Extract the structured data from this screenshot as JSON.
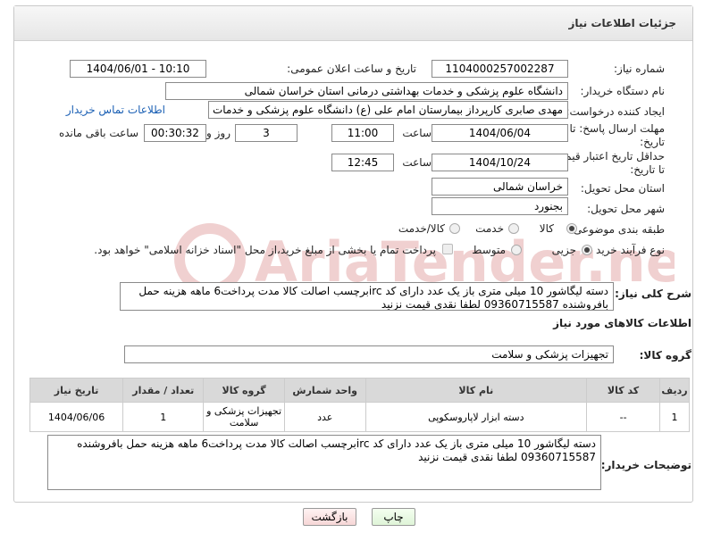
{
  "header": {
    "title": "جزئیات اطلاعات نیاز"
  },
  "fields": {
    "need_number_label": "شماره نیاز:",
    "need_number": "1104000257002287",
    "announce_label": "تاریخ و ساعت اعلان عمومی:",
    "announce_value": "1404/06/01 - 10:10",
    "buyer_org_label": "نام دستگاه خریدار:",
    "buyer_org": "دانشگاه علوم پزشکی و خدمات بهداشتی درمانی استان خراسان شمالی",
    "creator_label": "ایجاد کننده درخواست:",
    "creator": "مهدی صابری کارپرداز بیمارستان امام علی (ع) دانشگاه علوم پزشکی و خدمات بهداشتی",
    "contact_link": "اطلاعات تماس خریدار",
    "deadline_label": "مهلت ارسال پاسخ: تا تاریخ:",
    "deadline_date": "1404/06/04",
    "time_label": "ساعت",
    "deadline_time": "11:00",
    "days_value": "3",
    "days_label": "روز و",
    "remaining_time": "00:30:32",
    "remaining_label": "ساعت باقی مانده",
    "validity_label": "حداقل تاریخ اعتبار قیمت: تا تاریخ:",
    "validity_date": "1404/10/24",
    "validity_time": "12:45",
    "province_label": "استان محل تحویل:",
    "province": "خراسان شمالی",
    "city_label": "شهر محل تحویل:",
    "city": "بجنورد",
    "category_label": "طبقه بندی موضوعی:",
    "category_options": [
      "کالا",
      "خدمت",
      "کالا/خدمت"
    ],
    "process_label": "نوع فرآیند خرید :",
    "process_options": [
      "جزیی",
      "متوسط"
    ],
    "payment_note": "پرداخت تمام یا بخشی از مبلغ خرید،از محل \"اسناد خزانه اسلامی\" خواهد بود."
  },
  "description": {
    "label": "شرح کلی نیاز:",
    "text": "دسته لیگاشور 10 میلی متری باز یک عدد دارای کد ircبرچسب اصالت کالا مدت پرداخت6 ماهه هزینه حمل بافروشنده 09360715587 لطفا نقدی قیمت نزنید"
  },
  "goods": {
    "section_title": "اطلاعات کالاهای مورد نیاز",
    "group_label": "گروه کالا:",
    "group_value": "تجهیزات پزشکی و سلامت",
    "columns": [
      "ردیف",
      "کد کالا",
      "نام کالا",
      "واحد شمارش",
      "گروه کالا",
      "تعداد / مقدار",
      "تاریخ نیاز"
    ],
    "rows": [
      {
        "row": "1",
        "code": "--",
        "name": "دسته ابزار لاپاروسکوپی",
        "unit": "عدد",
        "group": "تجهیزات پزشکی و سلامت",
        "qty": "1",
        "date": "1404/06/06"
      }
    ]
  },
  "buyer_notes": {
    "label": "توضیحات خریدار:",
    "text": "دسته لیگاشور 10 میلی متری باز یک عدد دارای کد ircبرچسب اصالت کالا مدت پرداخت6 ماهه هزینه حمل بافروشنده 09360715587 لطفا نقدی قیمت نزنید"
  },
  "buttons": {
    "print": "چاپ",
    "back": "بازگشت"
  },
  "watermark": "AriaTender.net"
}
